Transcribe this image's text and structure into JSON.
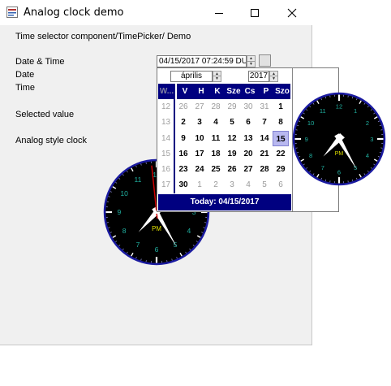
{
  "window": {
    "title": "Analog clock demo",
    "controls": [
      "minimize",
      "maximize",
      "close"
    ]
  },
  "heading": "Time selector component/TimePicker/ Demo",
  "labels": {
    "date_time": "Date & Time",
    "date": "Date",
    "time": "Time",
    "selected_value": "Selected value",
    "analog_clock": "Analog style clock"
  },
  "date_time_field": {
    "value": "04/15/2017 07:24:59 DU"
  },
  "calendar": {
    "month": "április",
    "year": "2017",
    "week_header": "W...",
    "weekdays": [
      "V",
      "H",
      "K",
      "Sze",
      "Cs",
      "P",
      "Szo"
    ],
    "weeks": [
      {
        "wk": "12",
        "days": [
          "26",
          "27",
          "28",
          "29",
          "30",
          "31",
          "1"
        ],
        "other": [
          0,
          1,
          2,
          3,
          4,
          5
        ]
      },
      {
        "wk": "13",
        "days": [
          "2",
          "3",
          "4",
          "5",
          "6",
          "7",
          "8"
        ],
        "other": []
      },
      {
        "wk": "14",
        "days": [
          "9",
          "10",
          "11",
          "12",
          "13",
          "14",
          "15"
        ],
        "other": [],
        "selected": 6
      },
      {
        "wk": "15",
        "days": [
          "16",
          "17",
          "18",
          "19",
          "20",
          "21",
          "22"
        ],
        "other": []
      },
      {
        "wk": "16",
        "days": [
          "23",
          "24",
          "25",
          "26",
          "27",
          "28",
          "29"
        ],
        "other": []
      },
      {
        "wk": "17",
        "days": [
          "30",
          "1",
          "2",
          "3",
          "4",
          "5",
          "6"
        ],
        "other": [
          1,
          2,
          3,
          4,
          5,
          6
        ]
      }
    ],
    "today_label": "Today: 04/15/2017"
  },
  "clock": {
    "numbers": [
      "12",
      "1",
      "2",
      "3",
      "4",
      "5",
      "6",
      "7",
      "8",
      "9",
      "10",
      "11"
    ],
    "am_pm": "PM",
    "time": {
      "hour": 7,
      "minute": 24,
      "second": 59
    },
    "colors": {
      "face": "#000000",
      "rim": "#1a1aa0",
      "numbers": "#20b0a0",
      "hands": "#ffffff",
      "second_hand": "#cc0000",
      "ampm": "#e0e000"
    }
  }
}
